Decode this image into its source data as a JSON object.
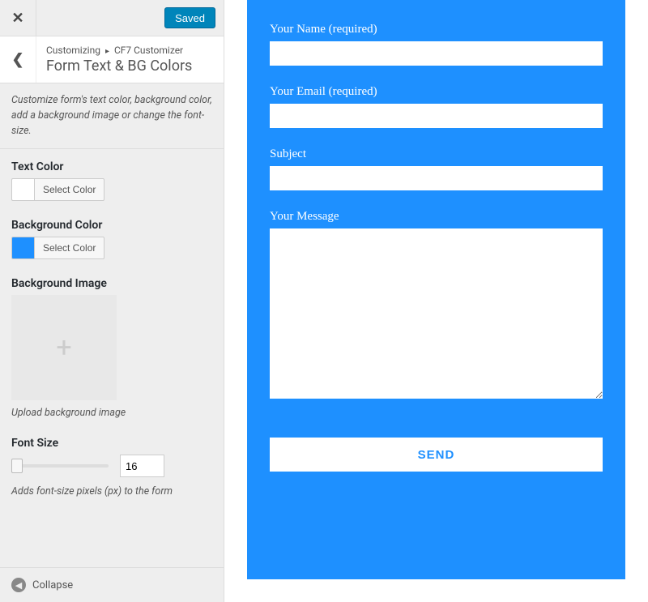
{
  "header": {
    "saved_label": "Saved"
  },
  "breadcrumb": {
    "root": "Customizing",
    "section": "CF7 Customizer",
    "title": "Form Text & BG Colors"
  },
  "description": "Customize form's text color, background color, add a background image or change the font-size.",
  "controls": {
    "text_color": {
      "label": "Text Color",
      "button": "Select Color",
      "swatch": "#ffffff"
    },
    "background_color": {
      "label": "Background Color",
      "button": "Select Color",
      "swatch": "#1e90ff"
    },
    "background_image": {
      "label": "Background Image",
      "hint": "Upload background image"
    },
    "font_size": {
      "label": "Font Size",
      "value": "16",
      "hint": "Adds font-size pixels (px) to the form"
    }
  },
  "collapse_label": "Collapse",
  "form": {
    "name_label": "Your Name (required)",
    "email_label": "Your Email (required)",
    "subject_label": "Subject",
    "message_label": "Your Message",
    "send_label": "SEND"
  }
}
